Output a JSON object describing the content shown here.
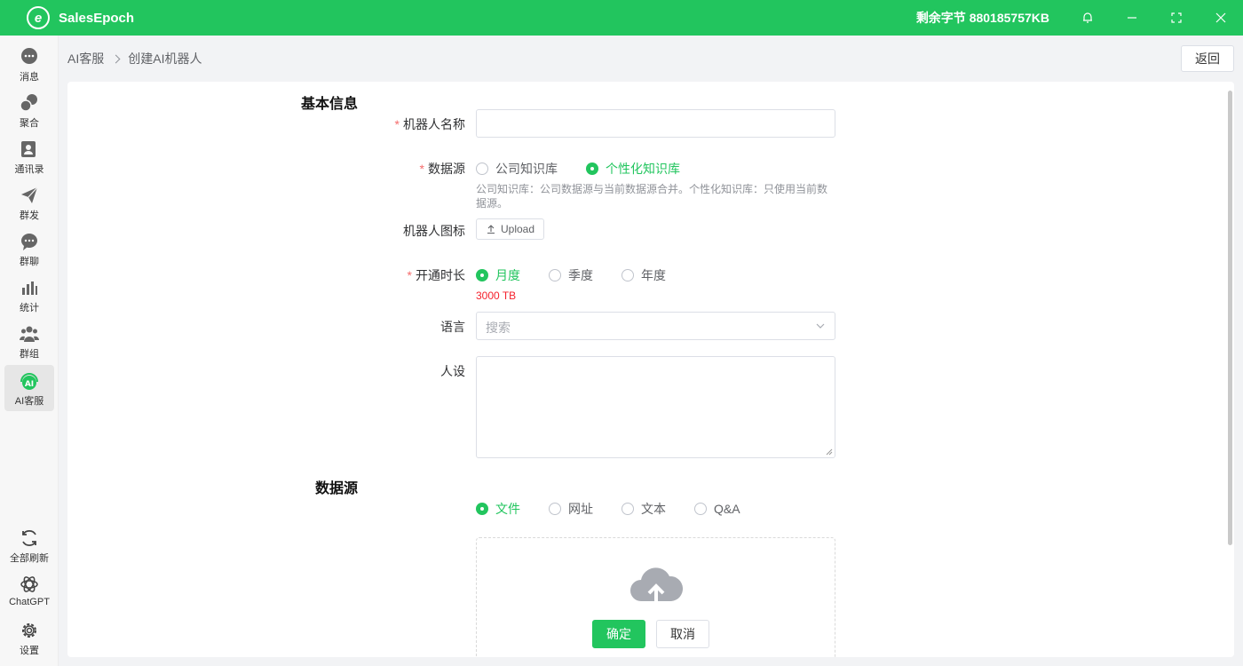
{
  "app": {
    "title": "SalesEpoch",
    "logo_letter": "e",
    "bytes_label": "剩余字节 880185757KB"
  },
  "sidebar": {
    "items": [
      {
        "label": "消息",
        "icon": "chat-bubble-icon"
      },
      {
        "label": "聚合",
        "icon": "chat-multi-icon"
      },
      {
        "label": "通讯录",
        "icon": "contacts-icon"
      },
      {
        "label": "群发",
        "icon": "paper-plane-icon"
      },
      {
        "label": "群聊",
        "icon": "group-chat-icon"
      },
      {
        "label": "统计",
        "icon": "bar-chart-icon"
      },
      {
        "label": "群组",
        "icon": "users-icon"
      },
      {
        "label": "AI客服",
        "icon": "ai-headset-icon"
      }
    ],
    "bottom": [
      {
        "label": "全部刷新",
        "icon": "refresh-icon"
      },
      {
        "label": "ChatGPT",
        "icon": "chatgpt-icon"
      },
      {
        "label": "设置",
        "icon": "gear-icon"
      }
    ]
  },
  "breadcrumb": {
    "root": "AI客服",
    "current": "创建AI机器人"
  },
  "header": {
    "back_label": "返回"
  },
  "form": {
    "basic_title": "基本信息",
    "name_label": "机器人名称",
    "name_value": "",
    "source_label": "数据源",
    "source_options": [
      "公司知识库",
      "个性化知识库"
    ],
    "source_hint": "公司知识库：公司数据源与当前数据源合并。个性化知识库：只使用当前数据源。",
    "icon_label": "机器人图标",
    "upload_label": "Upload",
    "duration_label": "开通时长",
    "duration_options": [
      "月度",
      "季度",
      "年度"
    ],
    "duration_price": "3000 TB",
    "language_label": "语言",
    "language_placeholder": "搜索",
    "persona_label": "人设",
    "persona_value": "",
    "datasource_title": "数据源",
    "datasource_options": [
      "文件",
      "网址",
      "文本",
      "Q&A"
    ]
  },
  "footer": {
    "confirm_label": "确定",
    "cancel_label": "取消"
  },
  "colors": {
    "accent": "#22c55e",
    "required": "#f56c6c",
    "price": "#f5222d"
  }
}
